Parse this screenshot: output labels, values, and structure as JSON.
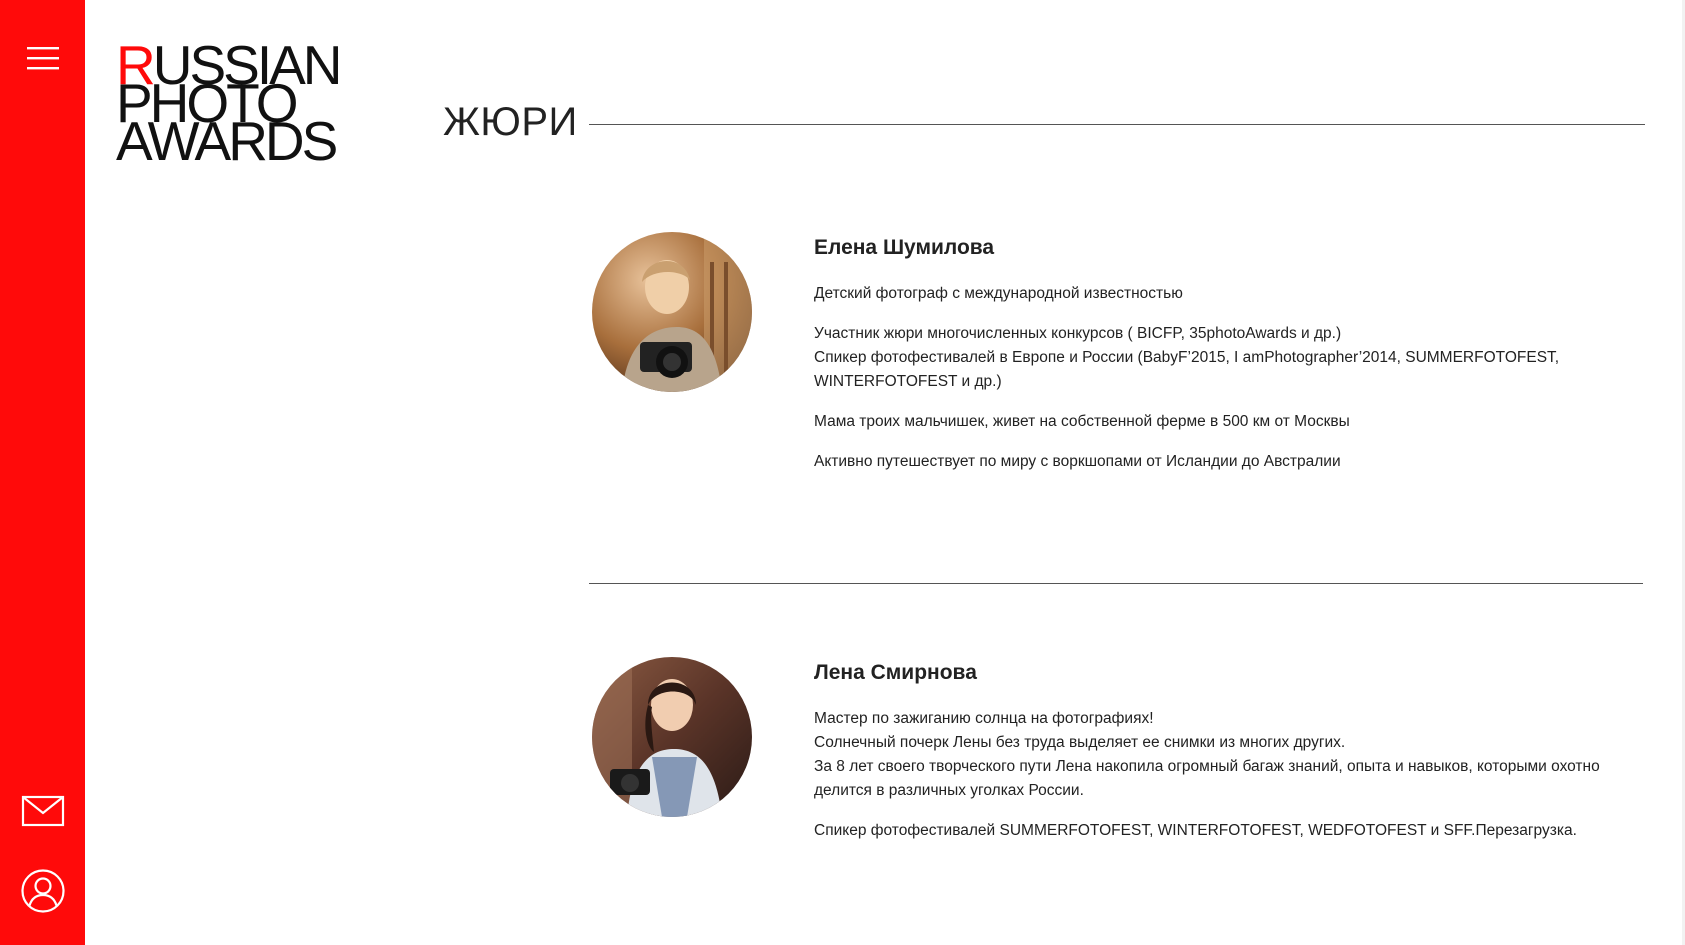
{
  "logo": {
    "first_letter": "R",
    "line1_rest": "USSIAN",
    "line2": "PHOTO",
    "line3": "AWARDS"
  },
  "page": {
    "title": "ЖЮРИ"
  },
  "sidebar": {
    "accent_color": "#ff0a0a",
    "icons": [
      "hamburger-menu-icon",
      "mail-icon",
      "user-icon"
    ]
  },
  "jury": [
    {
      "name": "Елена Шумилова",
      "paragraphs": [
        "Детский фотограф с международной известностью",
        "Участник жюри многочисленных конкурсов ( BICFP, 35photoAwards и др.)\nСпикер фотофестивалей в Европе и России (BabyF’2015, I amPhotographer’2014, SUMMERFOTOFEST, WINTERFOTOFEST и др.)",
        "Мама троих мальчишек, живет на собственной ферме в 500 км от Москвы",
        "Активно путешествует по миру с воркшопами от Исландии до Австралии"
      ]
    },
    {
      "name": "Лена Смирнова",
      "paragraphs": [
        "Мастер по зажиганию солнца на фотографиях!\nСолнечный почерк Лены без труда выделяет ее снимки из многих других.\nЗа 8 лет своего творческого пути Лена накопила огромный багаж знаний, опыта и навыков, которыми охотно делится в различных уголках России.",
        "Спикер фотофестивалей SUMMERFOTOFEST, WINTERFOTOFEST, WEDFOTOFEST и SFF.Перезагрузка."
      ]
    }
  ]
}
